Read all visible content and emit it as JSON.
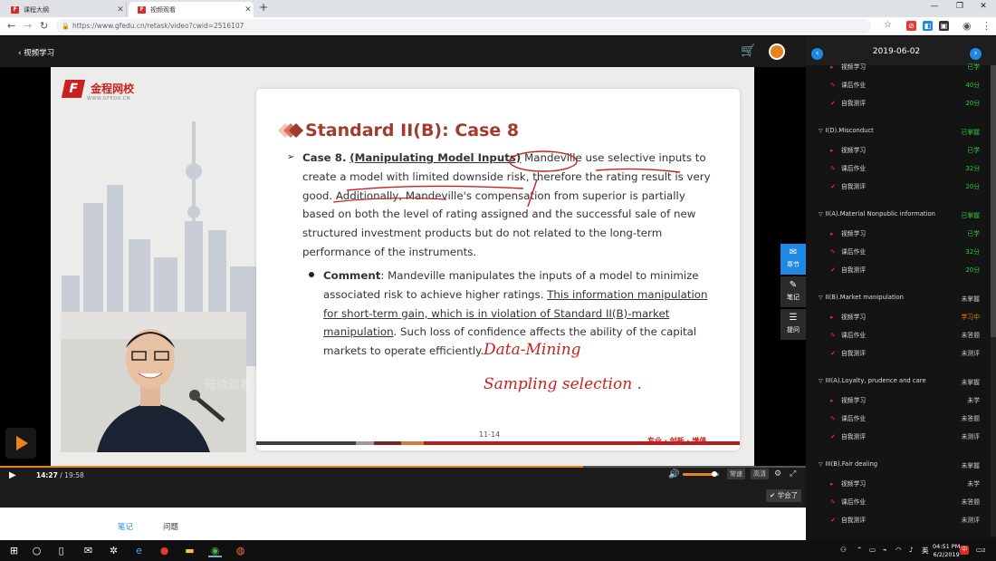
{
  "browser": {
    "tabs": [
      {
        "title": "课程大纲",
        "active": false
      },
      {
        "title": "视频观看",
        "active": true
      }
    ],
    "url": "https://www.gfedu.cn/retask/video?cwid=2516107"
  },
  "player": {
    "back_label": "视频学习",
    "current_time": "14:27",
    "total_time": "19:58",
    "progress": 0.724,
    "volume": 0.9,
    "quality_options": [
      "常速",
      "高清"
    ],
    "learned_label": "学会了",
    "side_tools": [
      {
        "label": "章节",
        "icon": "chapter-icon"
      },
      {
        "label": "笔记",
        "icon": "pencil-icon"
      },
      {
        "label": "提问",
        "icon": "question-stack-icon"
      }
    ],
    "watermark": "陆续观看，加油!"
  },
  "slide": {
    "brand_name": "金程网校",
    "brand_sub": "WWW.GFEDU.CN",
    "title": "Standard II(B): Case 8",
    "case_label": "Case 8.",
    "case_heading": "(Manipulating Model Inputs)",
    "case_text": "Mandeville use selective inputs to create a model with limited downside risk, therefore the rating result is very good. Additionally, Mandeville's compensation from superior is partially based on both the level of rating assigned and the successful sale of new structured investment products but do not related to the long-term performance of the instruments.",
    "comment_label": "Comment",
    "comment_text_1": ": Mandeville manipulates the inputs of a model to minimize associated risk to achieve higher ratings.",
    "comment_underlined": "This information manipulation for short-term gain, which is in violation of Standard II(B)-market manipulation",
    "comment_text_2": ". Such loss of confidence affects the ability of the capital markets to operate efficiently.",
    "handwriting_1": "Data-Mining",
    "handwriting_2": "Sampling selection .",
    "page_number": "11-14",
    "slogan": "专业 · 创新 · 增值"
  },
  "notes_tabs": [
    {
      "label": "笔记",
      "active": true
    },
    {
      "label": "问题",
      "active": false
    }
  ],
  "sidebar": {
    "date": "2019-06-02",
    "sections": [
      {
        "title": "",
        "status": "",
        "items": [
          {
            "label": "视频学习",
            "status": "已学",
            "icon": "play-icon"
          },
          {
            "label": "课后作业",
            "status": "40分",
            "icon": "edit-icon"
          },
          {
            "label": "自我测评",
            "status": "20分",
            "icon": "check-icon"
          }
        ]
      },
      {
        "title": "I(D).Misconduct",
        "status": "已掌握",
        "items": [
          {
            "label": "视频学习",
            "status": "已学",
            "icon": "play-icon"
          },
          {
            "label": "课后作业",
            "status": "32分",
            "icon": "edit-icon"
          },
          {
            "label": "自我测评",
            "status": "20分",
            "icon": "check-icon"
          }
        ]
      },
      {
        "title": "II(A).Material Nonpublic information",
        "status": "已掌握",
        "items": [
          {
            "label": "视频学习",
            "status": "已学",
            "icon": "play-icon"
          },
          {
            "label": "课后作业",
            "status": "32分",
            "icon": "edit-icon"
          },
          {
            "label": "自我测评",
            "status": "20分",
            "icon": "check-icon"
          }
        ]
      },
      {
        "title": "II(B).Market manipulation",
        "status": "未掌握",
        "items": [
          {
            "label": "视频学习",
            "status": "学习中",
            "icon": "play-icon"
          },
          {
            "label": "课后作业",
            "status": "未答题",
            "icon": "edit-icon"
          },
          {
            "label": "自我测评",
            "status": "未测评",
            "icon": "check-icon"
          }
        ]
      },
      {
        "title": "III(A).Loyalty, prudence and care",
        "status": "未掌握",
        "items": [
          {
            "label": "视频学习",
            "status": "未学",
            "icon": "play-icon"
          },
          {
            "label": "课后作业",
            "status": "未答题",
            "icon": "edit-icon"
          },
          {
            "label": "自我测评",
            "status": "未测评",
            "icon": "check-icon"
          }
        ]
      },
      {
        "title": "III(B).Fair dealing",
        "status": "未掌握",
        "items": [
          {
            "label": "视频学习",
            "status": "未学",
            "icon": "play-icon"
          },
          {
            "label": "课后作业",
            "status": "未答题",
            "icon": "edit-icon"
          },
          {
            "label": "自我测评",
            "status": "未测评",
            "icon": "check-icon"
          }
        ]
      }
    ]
  },
  "taskbar": {
    "time": "04:51 PM",
    "date": "6/2/2019",
    "lang": "英",
    "tray_input": "中",
    "notifications": "2"
  },
  "colors": {
    "accent": "#e8821c",
    "brand_red": "#c8211f",
    "status_green": "#2ecc40",
    "link_blue": "#1e88e5"
  }
}
